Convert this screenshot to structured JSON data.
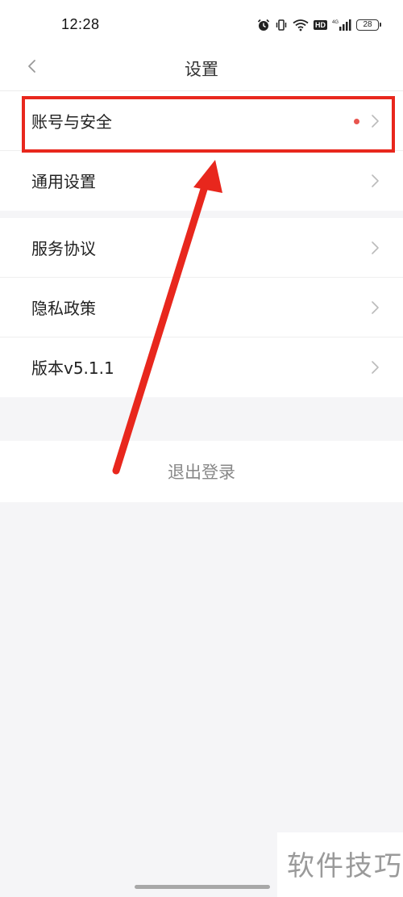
{
  "status_bar": {
    "time": "12:28",
    "battery": "28",
    "hd_badge": "HD",
    "icons": [
      "alarm-icon",
      "vibrate-icon",
      "wifi-icon",
      "hd-icon",
      "signal-icon",
      "battery-icon"
    ]
  },
  "nav": {
    "title": "设置",
    "back_icon": "chevron-left-icon"
  },
  "settings": {
    "group1": [
      {
        "label": "账号与安全",
        "has_dot": true
      },
      {
        "label": "通用设置",
        "has_dot": false
      }
    ],
    "group2": [
      {
        "label": "服务协议"
      },
      {
        "label": "隐私政策"
      },
      {
        "label": "版本v5.1.1"
      }
    ]
  },
  "logout": {
    "label": "退出登录"
  },
  "annotation": {
    "highlight_color": "#e8271d",
    "arrow_color": "#e8271d"
  },
  "watermark": {
    "text": "软件技巧"
  },
  "colors": {
    "dot": "#e8554e",
    "background": "#f5f5f7"
  }
}
